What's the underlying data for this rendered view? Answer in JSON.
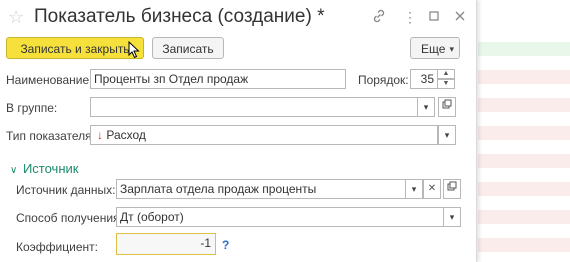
{
  "window": {
    "title": "Показатель бизнеса (создание) *",
    "icons": [
      "star-icon",
      "link-icon",
      "more-icon",
      "maximize-icon",
      "close-icon"
    ]
  },
  "toolbar": {
    "save_close_label": "Записать и закрыть",
    "save_label": "Записать",
    "more_label": "Еще"
  },
  "form": {
    "name_label": "Наименование:",
    "name_value": "Проценты зп Отдел продаж",
    "order_label": "Порядок:",
    "order_value": "35",
    "group_label": "В группе:",
    "group_value": "",
    "type_label": "Тип показателя:",
    "type_value": "Расход"
  },
  "source": {
    "section_label": "Источник",
    "data_source_label": "Источник данных:",
    "data_source_value": "Зарплата отдела продаж проценты",
    "method_label": "Способ получения:",
    "method_value": "Дт (оборот)",
    "coef_label": "Коэффициент:",
    "coef_value": "-1",
    "help_label": "?"
  },
  "colors": {
    "accent_yellow": "#f6e13c",
    "section_green": "#1c8a6d",
    "expense_arrow": "#c0392b",
    "focus_border": "#e0c040"
  }
}
